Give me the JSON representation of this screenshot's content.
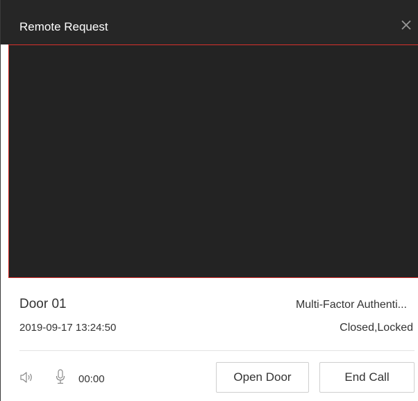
{
  "window": {
    "title": "Remote Request",
    "close_icon": "close-icon"
  },
  "video": {
    "background_color": "#232323",
    "border_color": "#d9302b"
  },
  "call_info": {
    "door_name": "Door 01",
    "auth_mode": "Multi-Factor Authenti...",
    "timestamp": "2019-09-17 13:24:50",
    "door_status": "Closed,Locked"
  },
  "controls": {
    "speaker_icon": "speaker-icon",
    "microphone_icon": "microphone-icon",
    "duration": "00:00",
    "open_door_label": "Open Door",
    "end_call_label": "End Call"
  }
}
